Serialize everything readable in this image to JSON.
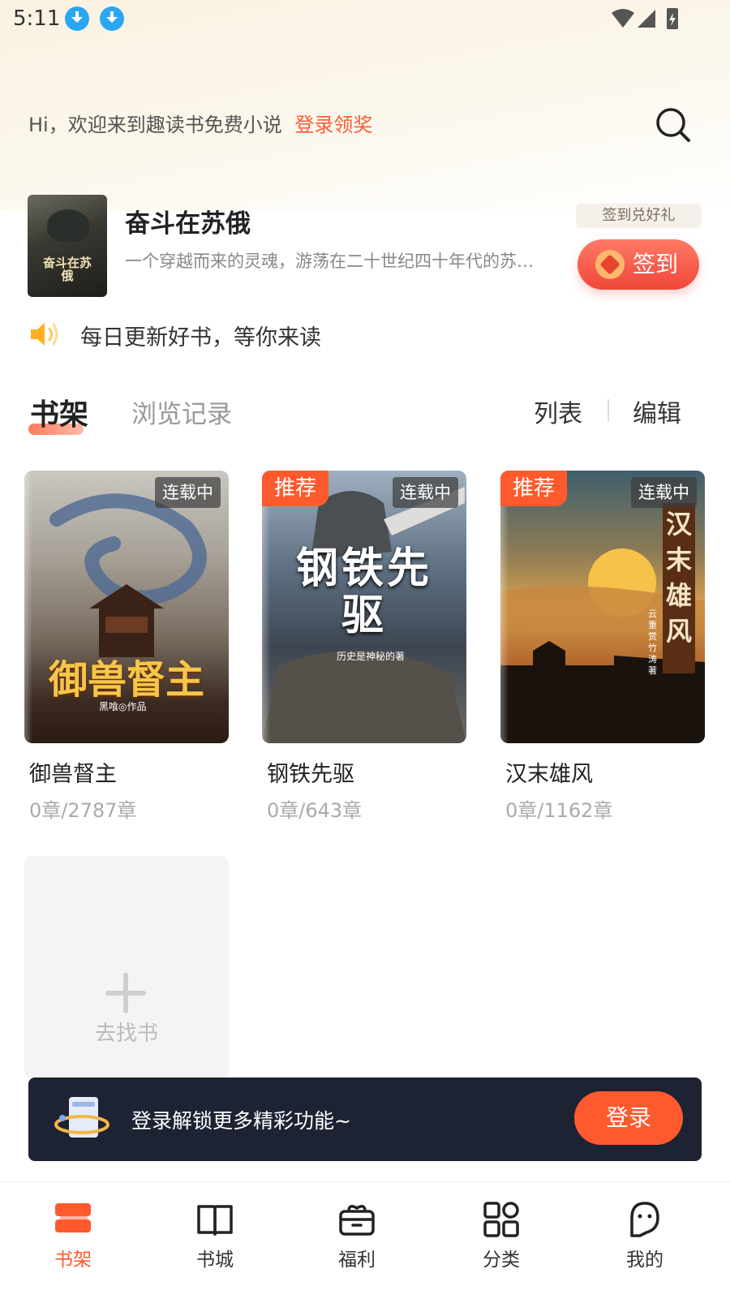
{
  "status_bar": {
    "time": "5:11",
    "icons": [
      "download-icon",
      "download-icon",
      "wifi-icon",
      "cellular-signal-icon",
      "battery-charging-icon"
    ]
  },
  "header": {
    "greeting": "Hi，欢迎来到趣读书免费小说",
    "login_reward_link": "登录领奖",
    "search_icon": "search-icon"
  },
  "recommendation": {
    "cover_caption": "奋斗在苏俄",
    "title": "奋斗在苏俄",
    "description": "一个穿越而来的灵魂，游荡在二十世纪四十年代的苏联…",
    "sign_tip": "签到兑好礼",
    "sign_button": "签到"
  },
  "notice": {
    "icon": "speaker-icon",
    "text": "每日更新好书，等你来读"
  },
  "shelf_tabs": {
    "active": "书架",
    "history": "浏览记录",
    "list_action": "列表",
    "edit_action": "编辑"
  },
  "books": [
    {
      "cover_title": "御兽督主",
      "cover_author": "黑喰◎作品",
      "title": "御兽督主",
      "progress": "0章/2787章",
      "status_tag": "连载中",
      "recommend_tag": ""
    },
    {
      "cover_title": "钢铁先驱",
      "cover_author": "历史是神秘的著",
      "title": "钢铁先驱",
      "progress": "0章/643章",
      "status_tag": "连载中",
      "recommend_tag": "推荐"
    },
    {
      "cover_title": "汉末雄风",
      "cover_author": "云重赏竹涛 著",
      "title": "汉末雄风",
      "progress": "0章/1162章",
      "status_tag": "连载中",
      "recommend_tag": "推荐"
    }
  ],
  "find_book": {
    "label": "去找书"
  },
  "login_bar": {
    "text": "登录解锁更多精彩功能~",
    "button": "登录"
  },
  "bottom_nav": [
    {
      "label": "书架",
      "icon": "bookshelf-icon",
      "active": true
    },
    {
      "label": "书城",
      "icon": "open-book-icon",
      "active": false
    },
    {
      "label": "福利",
      "icon": "gift-box-icon",
      "active": false
    },
    {
      "label": "分类",
      "icon": "grid-icon",
      "active": false
    },
    {
      "label": "我的",
      "icon": "profile-icon",
      "active": false
    }
  ],
  "colors": {
    "accent": "#ff5a2e",
    "login_bar_bg": "#1e2333",
    "sign_button": "#f0463a"
  }
}
